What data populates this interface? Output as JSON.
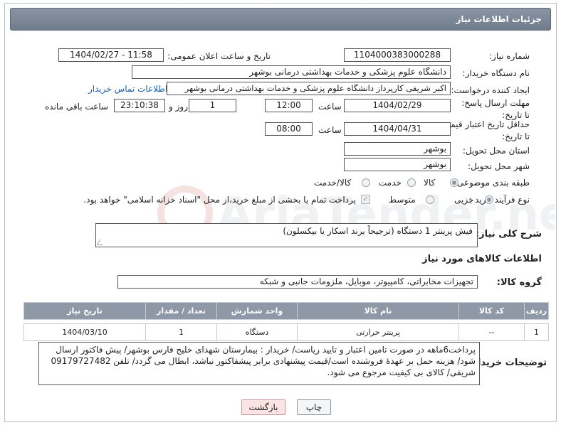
{
  "header": {
    "title": "جزئیات اطلاعات نیاز"
  },
  "fields": {
    "need_number_label": "شماره نیاز:",
    "need_number": "1104000383000288",
    "announce_label": "تاریخ و ساعت اعلان عمومی:",
    "announce_value": "1404/02/27 - 11:58",
    "buyer_org_label": "نام دستگاه خریدار:",
    "buyer_org": "دانشگاه علوم پزشکی و خدمات بهداشتی درمانی بوشهر",
    "creator_label": "ایجاد کننده درخواست:",
    "creator": "اکبر شریفی کارپرداز دانشگاه علوم پزشکی و خدمات بهداشتی درمانی بوشهر",
    "contact_link": "اطلاعات تماس خریدار",
    "deadline_label": "مهلت ارسال پاسخ: تا تاریخ:",
    "deadline_date": "1404/02/29",
    "time_label": "ساعت",
    "deadline_time": "12:00",
    "days_value": "1",
    "days_label": "روز و",
    "remaining_time": "23:10:38",
    "remaining_label": "ساعت باقی مانده",
    "price_validity_label": "حداقل تاریخ اعتبار قیمت: تا تاریخ:",
    "price_validity_date": "1404/04/31",
    "price_validity_time": "08:00",
    "province_label": "استان محل تحویل:",
    "province": "بوشهر",
    "city_label": "شهر محل تحویل:",
    "city": "بوشهر",
    "category_label": "طبقه بندی موضوعی:",
    "category_options": [
      "کالا",
      "خدمت",
      "کالا/خدمت"
    ],
    "process_label": "نوع فرآیند خرید :",
    "process_options": [
      "جزیی",
      "متوسط"
    ],
    "payment_note": "پرداخت تمام یا بخشی از مبلغ خرید،از محل \"اسناد خزانه اسلامی\" خواهد بود."
  },
  "description": {
    "label": "شرح کلی نیاز:",
    "text": "فیش پرینتر 1 دستگاه (ترجیحاً برند اسکار یا بیکسلون)"
  },
  "goods": {
    "section_title": "اطلاعات کالاهای مورد نیاز",
    "group_label": "گروه کالا:",
    "group_value": "تجهیزات مخابراتی، کامپیوتر، موبایل، ملزومات جانبی و شبکه",
    "columns": [
      "ردیف",
      "کد کالا",
      "نام کالا",
      "واحد شمارش",
      "تعداد / مقدار",
      "تاریخ نیاز"
    ],
    "rows": [
      [
        "1",
        "--",
        "پرینتر حرارتی",
        "دستگاه",
        "1",
        "1404/03/10"
      ]
    ]
  },
  "buyer_notes": {
    "label": "توضیحات خریدار:",
    "text": "پرداخت6ماهه در صورت تامین اعتبار و تایید ریاست/ خریدار : بیمارستان شهدای خلیج فارس بوشهر/ پیش فاکتور ارسال شود/ هزینه حمل بر عهدهٔ فروشنده است/قیمت پیشنهادی برابر پیشفاکتور نباشد، ابطال می گردد/ تلفن 09179727482 شریفی/ کالای بی کیفیت مرجوع می شود."
  },
  "buttons": {
    "print": "چاپ",
    "back": "بازگشت"
  },
  "watermark": {
    "text": "AriaTender.neT"
  }
}
